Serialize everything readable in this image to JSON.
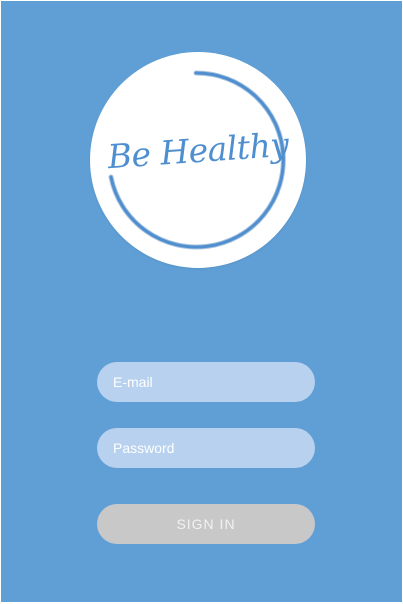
{
  "logo": {
    "text": "Be Healthy"
  },
  "form": {
    "email_placeholder": "E-mail",
    "password_placeholder": "Password",
    "signin_label": "SIGN IN"
  },
  "colors": {
    "background": "#5f9fd6",
    "logo_text": "#4f8fcf",
    "input_fill": "#b7d1ee",
    "button_fill": "#c8c8c8"
  }
}
